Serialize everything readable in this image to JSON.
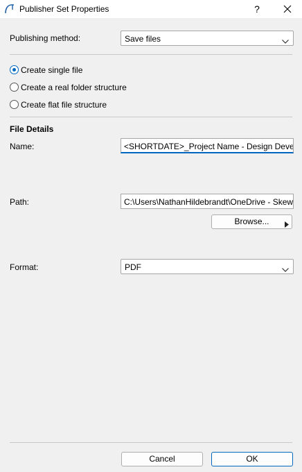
{
  "window": {
    "title": "Publisher Set Properties",
    "help_label": "?",
    "app_icon": "arc-icon",
    "close_icon": "close-icon"
  },
  "publishing": {
    "label": "Publishing method:",
    "value": "Save files"
  },
  "structure_options": [
    {
      "label": "Create single file",
      "checked": true
    },
    {
      "label": "Create a real folder structure",
      "checked": false
    },
    {
      "label": "Create flat file structure",
      "checked": false
    }
  ],
  "file_details": {
    "heading": "File Details",
    "name_label": "Name:",
    "name_value": "<SHORTDATE>_Project Name - Design Development",
    "path_label": "Path:",
    "path_value": "C:\\Users\\NathanHildebrandt\\OneDrive - Skewes",
    "browse_label": "Browse...",
    "format_label": "Format:",
    "format_value": "PDF"
  },
  "footer": {
    "cancel_label": "Cancel",
    "ok_label": "OK"
  },
  "colors": {
    "accent": "#0067c0",
    "background": "#f0f0f0"
  }
}
